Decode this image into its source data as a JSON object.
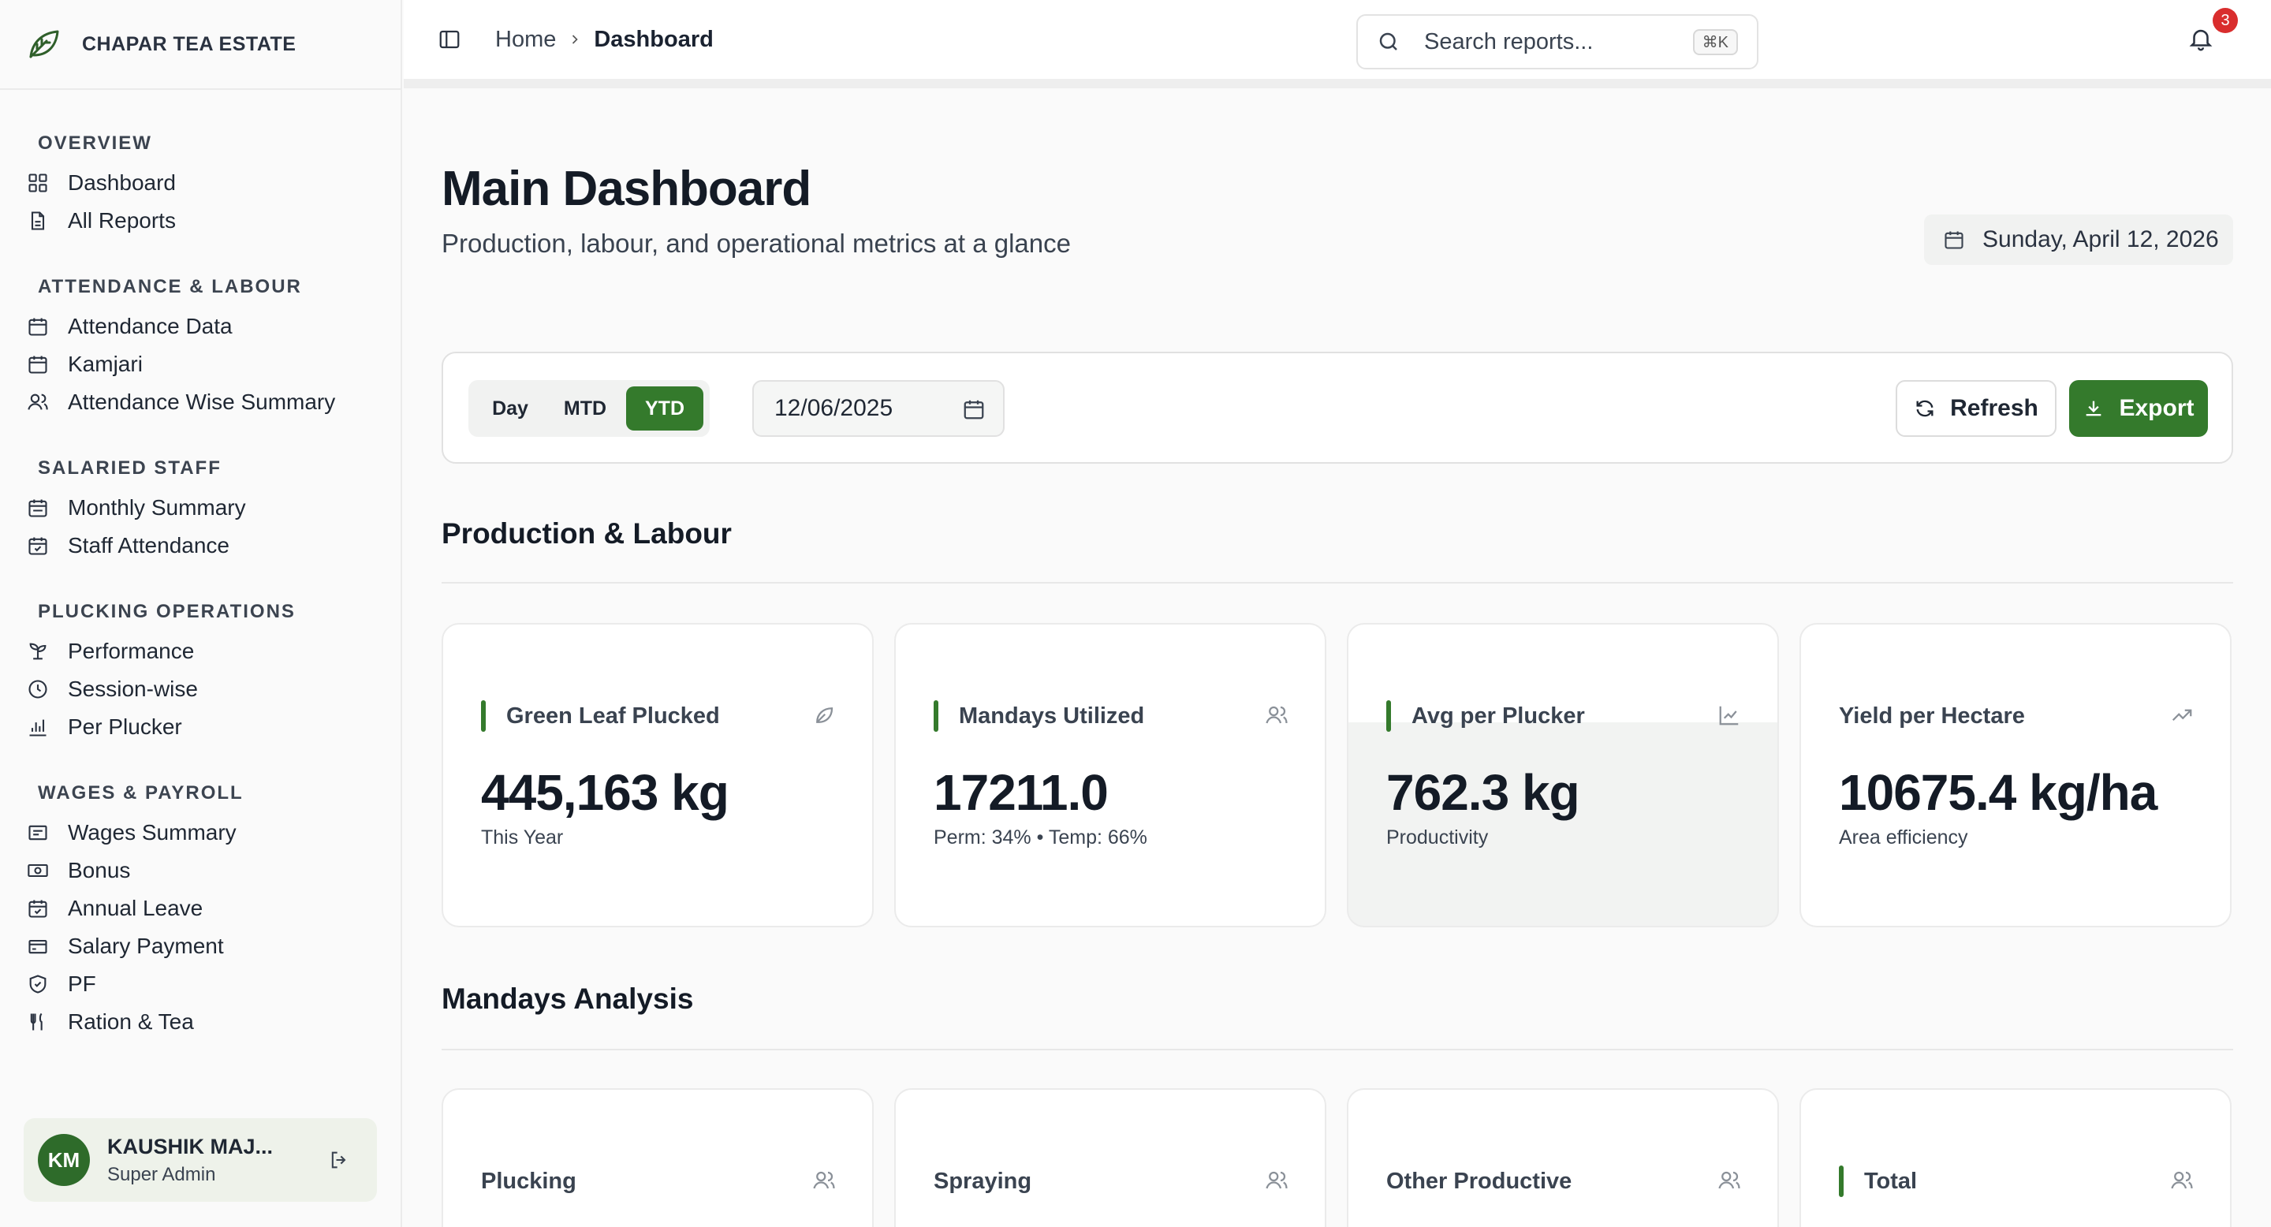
{
  "brand": {
    "name": "CHAPAR TEA ESTATE"
  },
  "sidebar": {
    "sections": [
      {
        "title": "OVERVIEW",
        "items": [
          {
            "label": "Dashboard",
            "icon": "grid-icon"
          },
          {
            "label": "All Reports",
            "icon": "file-icon"
          }
        ]
      },
      {
        "title": "ATTENDANCE & LABOUR",
        "items": [
          {
            "label": "Attendance Data",
            "icon": "calendar-icon"
          },
          {
            "label": "Kamjari",
            "icon": "calendar-icon"
          },
          {
            "label": "Attendance Wise Summary",
            "icon": "users-icon"
          }
        ]
      },
      {
        "title": "SALARIED STAFF",
        "items": [
          {
            "label": "Monthly Summary",
            "icon": "calendar-range-icon"
          },
          {
            "label": "Staff Attendance",
            "icon": "calendar-check-icon"
          }
        ]
      },
      {
        "title": "PLUCKING OPERATIONS",
        "items": [
          {
            "label": "Performance",
            "icon": "sprout-icon"
          },
          {
            "label": "Session-wise",
            "icon": "clock-icon"
          },
          {
            "label": "Per Plucker",
            "icon": "bar-chart-icon"
          }
        ]
      },
      {
        "title": "WAGES & PAYROLL",
        "items": [
          {
            "label": "Wages Summary",
            "icon": "receipt-icon"
          },
          {
            "label": "Bonus",
            "icon": "banknote-icon"
          },
          {
            "label": "Annual Leave",
            "icon": "calendar-check-icon"
          },
          {
            "label": "Salary Payment",
            "icon": "wallet-icon"
          },
          {
            "label": "PF",
            "icon": "shield-icon"
          },
          {
            "label": "Ration & Tea",
            "icon": "utensils-icon"
          }
        ]
      }
    ]
  },
  "user": {
    "initials": "KM",
    "name": "KAUSHIK MAJ...",
    "role": "Super Admin"
  },
  "topbar": {
    "breadcrumb_home": "Home",
    "breadcrumb_current": "Dashboard",
    "search_placeholder": "Search reports...",
    "search_shortcut": "⌘K",
    "notification_count": "3"
  },
  "header": {
    "title": "Main Dashboard",
    "subtitle": "Production, labour, and operational metrics at a glance",
    "date": "Sunday, April 12, 2026"
  },
  "filters": {
    "periods": [
      "Day",
      "MTD",
      "YTD"
    ],
    "selected_period": "YTD",
    "date_value": "12/06/2025",
    "refresh_label": "Refresh",
    "export_label": "Export"
  },
  "production": {
    "title": "Production & Labour",
    "cards": [
      {
        "label": "Green Leaf Plucked",
        "value": "445,163 kg",
        "sub": "This Year",
        "icon": "leaf-icon",
        "accent": true
      },
      {
        "label": "Mandays Utilized",
        "value": "17211.0",
        "sub": "Perm: 34% • Temp: 66%",
        "icon": "users-icon",
        "accent": true
      },
      {
        "label": "Avg per Plucker",
        "value": "762.3 kg",
        "sub": "Productivity",
        "icon": "line-chart-icon",
        "accent": true
      },
      {
        "label": "Yield per Hectare",
        "value": "10675.4 kg/ha",
        "sub": "Area efficiency",
        "icon": "trending-up-icon",
        "accent": false
      }
    ]
  },
  "mandays": {
    "title": "Mandays Analysis",
    "cards": [
      {
        "label": "Plucking",
        "icon": "users-icon",
        "accent": false
      },
      {
        "label": "Spraying",
        "icon": "users-icon",
        "accent": false
      },
      {
        "label": "Other Productive",
        "icon": "users-icon",
        "accent": false
      },
      {
        "label": "Total",
        "icon": "users-icon",
        "accent": true
      }
    ]
  },
  "colors": {
    "brand_green": "#347a2c",
    "badge_red": "#d92d2d"
  }
}
